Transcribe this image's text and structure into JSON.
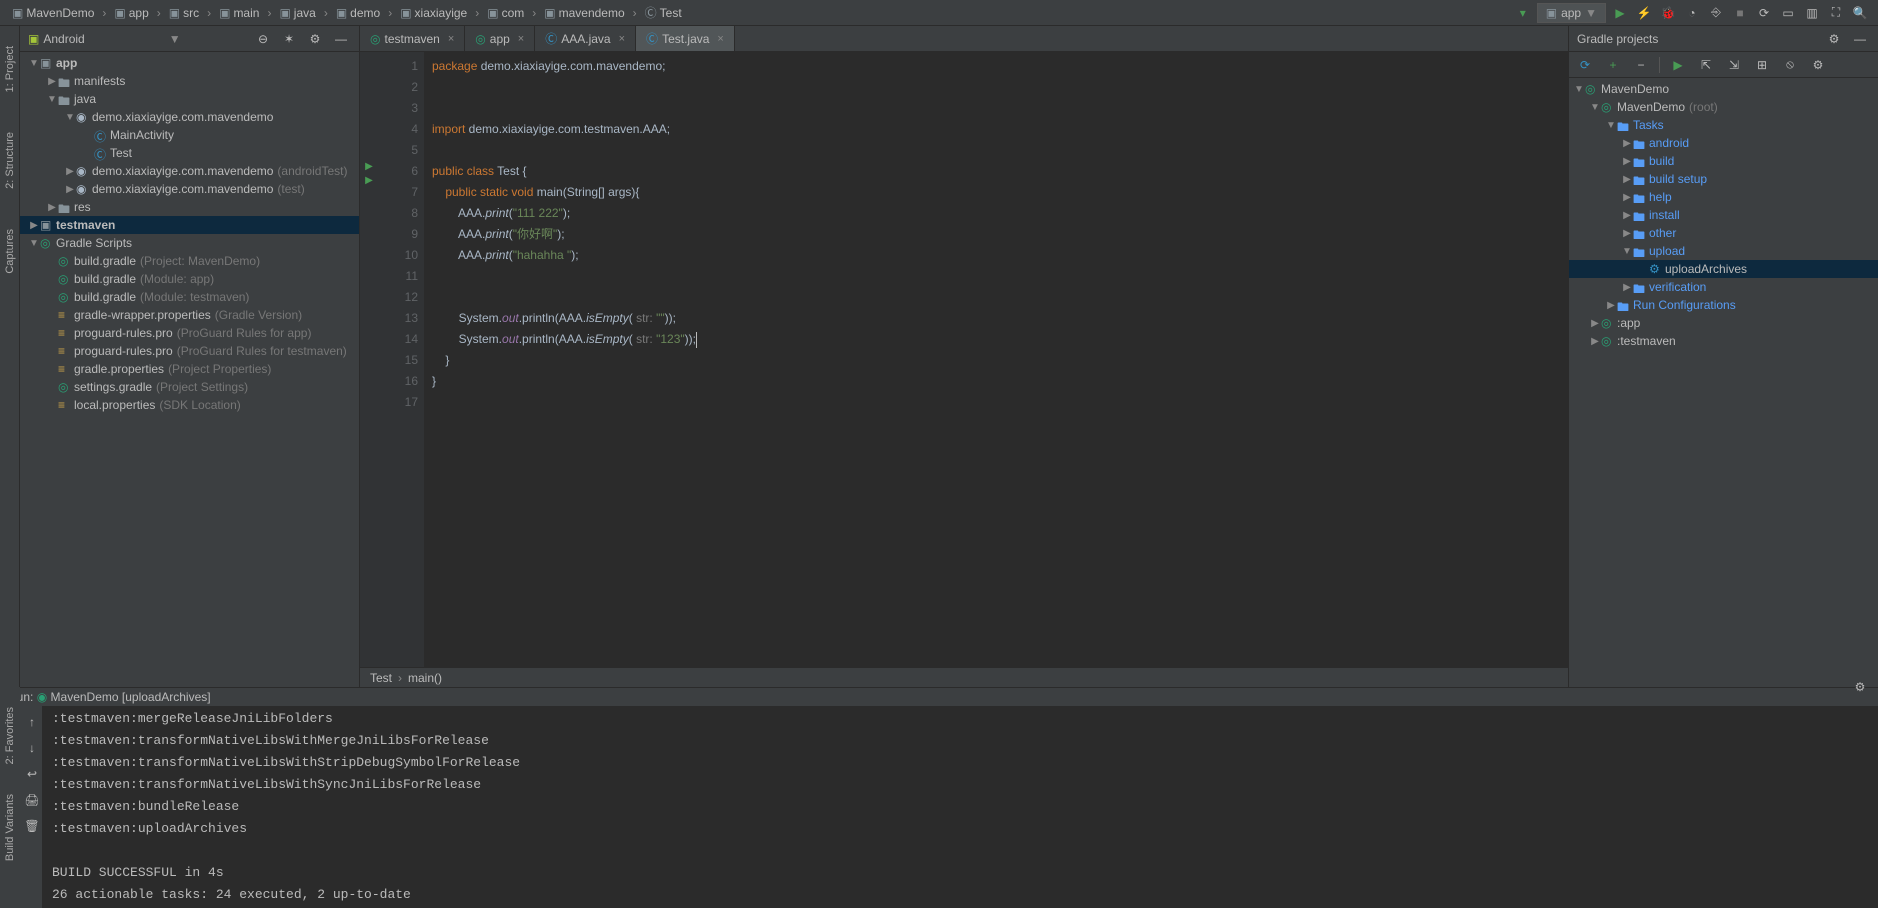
{
  "breadcrumb": [
    "MavenDemo",
    "app",
    "src",
    "main",
    "java",
    "demo",
    "xiaxiayige",
    "com",
    "mavendemo",
    "Test"
  ],
  "navRunConfig": "app",
  "projectPanel": {
    "viewLabel": "Android",
    "tree": [
      {
        "indent": 0,
        "exp": "▼",
        "icon": "module",
        "label": "app",
        "bold": true
      },
      {
        "indent": 1,
        "exp": "▶",
        "icon": "folder",
        "label": "manifests"
      },
      {
        "indent": 1,
        "exp": "▼",
        "icon": "folder",
        "label": "java"
      },
      {
        "indent": 2,
        "exp": "▼",
        "icon": "pkg",
        "label": "demo.xiaxiayige.com.mavendemo"
      },
      {
        "indent": 3,
        "exp": "",
        "icon": "class",
        "label": "MainActivity"
      },
      {
        "indent": 3,
        "exp": "",
        "icon": "class",
        "label": "Test"
      },
      {
        "indent": 2,
        "exp": "▶",
        "icon": "pkg",
        "label": "demo.xiaxiayige.com.mavendemo",
        "hint": "(androidTest)"
      },
      {
        "indent": 2,
        "exp": "▶",
        "icon": "pkg",
        "label": "demo.xiaxiayige.com.mavendemo",
        "hint": "(test)"
      },
      {
        "indent": 1,
        "exp": "▶",
        "icon": "folder",
        "label": "res"
      },
      {
        "indent": 0,
        "exp": "▶",
        "icon": "module",
        "label": "testmaven",
        "bold": true,
        "selected": true
      },
      {
        "indent": 0,
        "exp": "▼",
        "icon": "gradle",
        "label": "Gradle Scripts"
      },
      {
        "indent": 1,
        "exp": "",
        "icon": "gfile",
        "label": "build.gradle",
        "hint": "(Project: MavenDemo)"
      },
      {
        "indent": 1,
        "exp": "",
        "icon": "gfile",
        "label": "build.gradle",
        "hint": "(Module: app)"
      },
      {
        "indent": 1,
        "exp": "",
        "icon": "gfile",
        "label": "build.gradle",
        "hint": "(Module: testmaven)"
      },
      {
        "indent": 1,
        "exp": "",
        "icon": "prop",
        "label": "gradle-wrapper.properties",
        "hint": "(Gradle Version)"
      },
      {
        "indent": 1,
        "exp": "",
        "icon": "prop",
        "label": "proguard-rules.pro",
        "hint": "(ProGuard Rules for app)"
      },
      {
        "indent": 1,
        "exp": "",
        "icon": "prop",
        "label": "proguard-rules.pro",
        "hint": "(ProGuard Rules for testmaven)"
      },
      {
        "indent": 1,
        "exp": "",
        "icon": "prop",
        "label": "gradle.properties",
        "hint": "(Project Properties)"
      },
      {
        "indent": 1,
        "exp": "",
        "icon": "gfile",
        "label": "settings.gradle",
        "hint": "(Project Settings)"
      },
      {
        "indent": 1,
        "exp": "",
        "icon": "prop",
        "label": "local.properties",
        "hint": "(SDK Location)"
      }
    ]
  },
  "tabs": [
    {
      "label": "testmaven",
      "icon": "gradle"
    },
    {
      "label": "app",
      "icon": "gradle"
    },
    {
      "label": "AAA.java",
      "icon": "class"
    },
    {
      "label": "Test.java",
      "icon": "class",
      "active": true
    }
  ],
  "lineNumbers": [
    1,
    2,
    3,
    4,
    5,
    6,
    7,
    8,
    9,
    10,
    11,
    12,
    13,
    14,
    15,
    16,
    17
  ],
  "code": {
    "l1_kw": "package",
    "l1_rest": " demo.xiaxiayige.com.mavendemo;",
    "l4_kw": "import",
    "l4_rest": " demo.xiaxiayige.com.testmaven.AAA;",
    "l6a": "public class ",
    "l6b": "Test {",
    "l7a": "    public static void ",
    "l7b": "main",
    "l7c": "(String[] args){",
    "l8a": "        AAA.",
    "l8b": "print",
    "l8c": "(",
    "l8s": "\"111 222\"",
    "l8d": ");",
    "l9a": "        AAA.",
    "l9b": "print",
    "l9c": "(",
    "l9s": "\"你好啊\"",
    "l9d": ");",
    "l10a": "        AAA.",
    "l10b": "print",
    "l10c": "(",
    "l10s": "\"hahahha \"",
    "l10d": ");",
    "l13a": "        System.",
    "l13b": "out",
    "l13c": ".println(AAA.",
    "l13d": "isEmpty",
    "l13e": "( ",
    "l13h": "str: ",
    "l13s": "\"\"",
    "l13f": "));",
    "l14a": "        System.",
    "l14b": "out",
    "l14c": ".println(AAA.",
    "l14d": "isEmpty",
    "l14e": "( ",
    "l14h": "str: ",
    "l14s": "\"123\"",
    "l14f": "));",
    "l15": "    }",
    "l16": "}"
  },
  "breadcrumbBottom": [
    "Test",
    "main()"
  ],
  "gradlePanel": {
    "title": "Gradle projects",
    "nodes": [
      {
        "indent": 0,
        "exp": "▼",
        "icon": "gradle",
        "label": "MavenDemo"
      },
      {
        "indent": 1,
        "exp": "▼",
        "icon": "gradle",
        "label": "MavenDemo",
        "hint": "(root)"
      },
      {
        "indent": 2,
        "exp": "▼",
        "icon": "folder",
        "label": "Tasks",
        "blue": true
      },
      {
        "indent": 3,
        "exp": "▶",
        "icon": "folder",
        "label": "android",
        "blue": true
      },
      {
        "indent": 3,
        "exp": "▶",
        "icon": "folder",
        "label": "build",
        "blue": true
      },
      {
        "indent": 3,
        "exp": "▶",
        "icon": "folder",
        "label": "build setup",
        "blue": true
      },
      {
        "indent": 3,
        "exp": "▶",
        "icon": "folder",
        "label": "help",
        "blue": true
      },
      {
        "indent": 3,
        "exp": "▶",
        "icon": "folder",
        "label": "install",
        "blue": true
      },
      {
        "indent": 3,
        "exp": "▶",
        "icon": "folder",
        "label": "other",
        "blue": true
      },
      {
        "indent": 3,
        "exp": "▼",
        "icon": "folder",
        "label": "upload",
        "blue": true
      },
      {
        "indent": 4,
        "exp": "",
        "icon": "task",
        "label": "uploadArchives",
        "selected": true
      },
      {
        "indent": 3,
        "exp": "▶",
        "icon": "folder",
        "label": "verification",
        "blue": true
      },
      {
        "indent": 2,
        "exp": "▶",
        "icon": "folder",
        "label": "Run Configurations",
        "blue": true
      },
      {
        "indent": 1,
        "exp": "▶",
        "icon": "gradle",
        "label": ":app"
      },
      {
        "indent": 1,
        "exp": "▶",
        "icon": "gradle",
        "label": ":testmaven"
      }
    ]
  },
  "runPanel": {
    "title": "Run:",
    "config": "MavenDemo [uploadArchives]",
    "lines": [
      ":testmaven:mergeReleaseJniLibFolders",
      ":testmaven:transformNativeLibsWithMergeJniLibsForRelease",
      ":testmaven:transformNativeLibsWithStripDebugSymbolForRelease",
      ":testmaven:transformNativeLibsWithSyncJniLibsForRelease",
      ":testmaven:bundleRelease",
      ":testmaven:uploadArchives",
      "",
      "BUILD SUCCESSFUL in 4s",
      "26 actionable tasks: 24 executed, 2 up-to-date"
    ]
  },
  "leftRail": [
    "1: Project",
    "2: Structure",
    "Captures"
  ],
  "bottomLeftRail": [
    "2: Favorites",
    "Build Variants"
  ]
}
